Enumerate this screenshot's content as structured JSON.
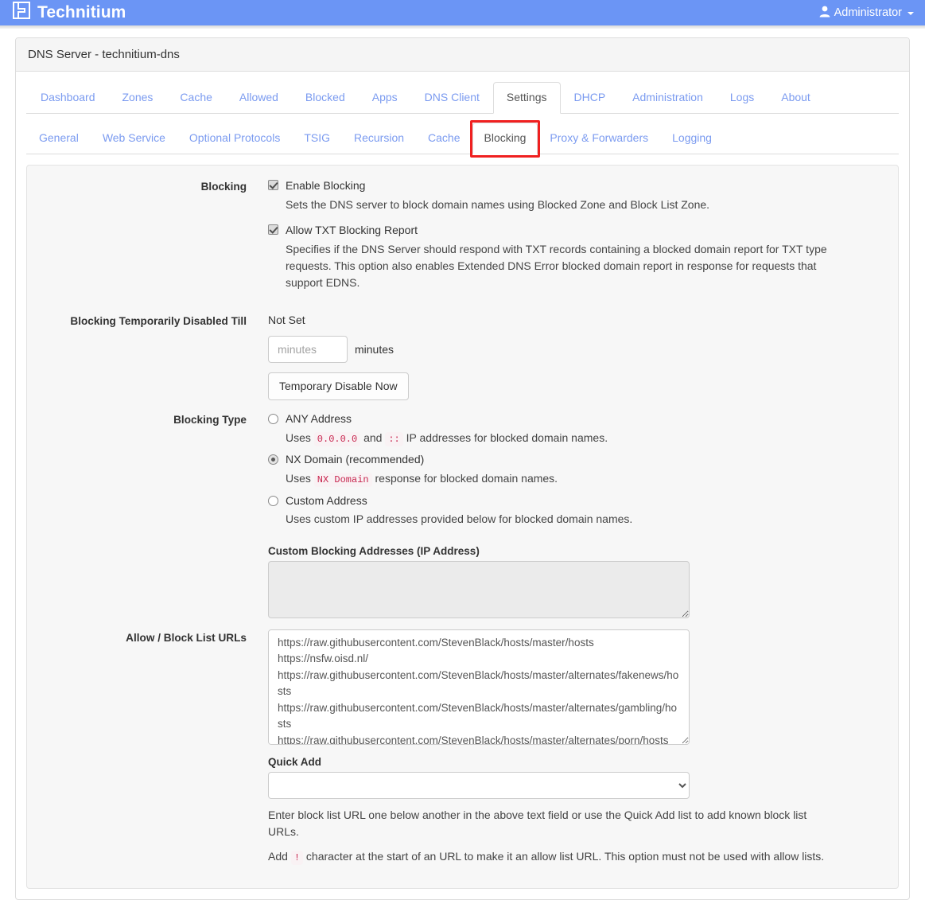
{
  "navbar": {
    "brand": "Technitium",
    "brand_logo_icon": "technitium-logo-icon",
    "user_icon": "user-icon",
    "user_label": "Administrator",
    "caret_icon": "caret-down-icon"
  },
  "panel": {
    "title": "DNS Server - technitium-dns"
  },
  "main_tabs": [
    {
      "label": "Dashboard",
      "active": false
    },
    {
      "label": "Zones",
      "active": false
    },
    {
      "label": "Cache",
      "active": false
    },
    {
      "label": "Allowed",
      "active": false
    },
    {
      "label": "Blocked",
      "active": false
    },
    {
      "label": "Apps",
      "active": false
    },
    {
      "label": "DNS Client",
      "active": false
    },
    {
      "label": "Settings",
      "active": true
    },
    {
      "label": "DHCP",
      "active": false
    },
    {
      "label": "Administration",
      "active": false
    },
    {
      "label": "Logs",
      "active": false
    },
    {
      "label": "About",
      "active": false
    }
  ],
  "sub_tabs": [
    {
      "label": "General",
      "active": false
    },
    {
      "label": "Web Service",
      "active": false
    },
    {
      "label": "Optional Protocols",
      "active": false
    },
    {
      "label": "TSIG",
      "active": false
    },
    {
      "label": "Recursion",
      "active": false
    },
    {
      "label": "Cache",
      "active": false
    },
    {
      "label": "Blocking",
      "active": true
    },
    {
      "label": "Proxy & Forwarders",
      "active": false
    },
    {
      "label": "Logging",
      "active": false
    }
  ],
  "highlight": {
    "color": "#f02020",
    "target": "Blocking"
  },
  "form": {
    "blocking": {
      "label": "Blocking",
      "enable_blocking": {
        "label": "Enable Blocking",
        "checked": true,
        "help": "Sets the DNS server to block domain names using Blocked Zone and Block List Zone."
      },
      "allow_txt_report": {
        "label": "Allow TXT Blocking Report",
        "checked": true,
        "help": "Specifies if the DNS Server should respond with TXT records containing a blocked domain report for TXT type requests. This option also enables Extended DNS Error blocked domain report in response for requests that support EDNS."
      }
    },
    "temp_disabled": {
      "label": "Blocking Temporarily Disabled Till",
      "value": "Not Set",
      "minutes_placeholder": "minutes",
      "minutes_value": "",
      "minutes_unit": "minutes",
      "button_label": "Temporary Disable Now"
    },
    "blocking_type": {
      "label": "Blocking Type",
      "options": [
        {
          "label": "ANY Address",
          "selected": false,
          "help_prefix": "Uses ",
          "code1": "0.0.0.0",
          "help_mid": " and ",
          "code2": "::",
          "help_suffix": " IP addresses for blocked domain names."
        },
        {
          "label": "NX Domain (recommended)",
          "selected": true,
          "help_prefix": "Uses ",
          "code1": "NX Domain",
          "help_suffix": " response for blocked domain names."
        },
        {
          "label": "Custom Address",
          "selected": false,
          "help_plain": "Uses custom IP addresses provided below for blocked domain names."
        }
      ],
      "custom_addresses": {
        "label": "Custom Blocking Addresses (IP Address)",
        "value": "",
        "disabled": true
      }
    },
    "list_urls": {
      "label": "Allow / Block List URLs",
      "value": "https://raw.githubusercontent.com/StevenBlack/hosts/master/hosts\nhttps://nsfw.oisd.nl/\nhttps://raw.githubusercontent.com/StevenBlack/hosts/master/alternates/fakenews/hosts\nhttps://raw.githubusercontent.com/StevenBlack/hosts/master/alternates/gambling/hosts\nhttps://raw.githubusercontent.com/StevenBlack/hosts/master/alternates/porn/hosts"
    },
    "quick_add": {
      "label": "Quick Add",
      "selected_value": "",
      "chevron_icon": "chevron-down-icon"
    },
    "notes": {
      "note1": "Enter block list URL one below another in the above text field or use the Quick Add list to add known block list URLs.",
      "note2_prefix": "Add ",
      "note2_code": "!",
      "note2_suffix": " character at the start of an URL to make it an allow list URL. This option must not be used with allow lists."
    }
  }
}
